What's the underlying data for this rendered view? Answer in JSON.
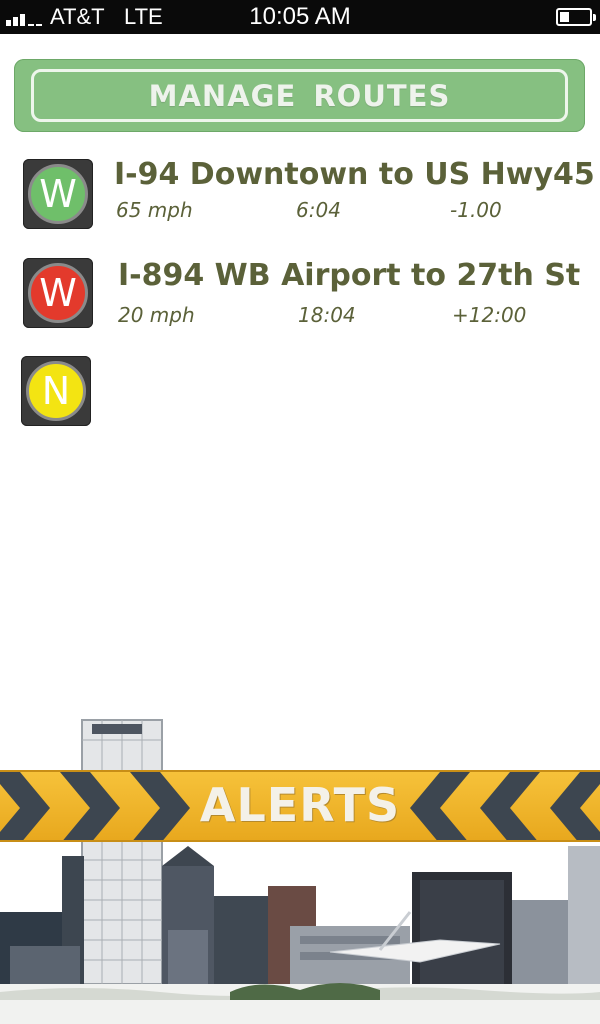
{
  "status_bar": {
    "carrier": "AT&T",
    "network": "LTE",
    "time": "10:05 AM",
    "signal_bars": 3,
    "battery_level": 0.3
  },
  "manage_routes": {
    "label": "MANAGE ROUTES"
  },
  "routes": [
    {
      "direction": "W",
      "status_color": "#6fbf6a",
      "title": "I-94 Downtown to US Hwy45",
      "speed": "65 mph",
      "time": "6:04",
      "delta": "-1.00"
    },
    {
      "direction": "W",
      "status_color": "#e33a2c",
      "title": "I-894 WB Airport to 27th St",
      "speed": "20 mph",
      "time": "18:04",
      "delta": "+12:00"
    },
    {
      "direction": "N",
      "status_color": "#f3e412",
      "title": "",
      "speed": "",
      "time": "",
      "delta": ""
    }
  ],
  "alerts": {
    "label": "ALERTS"
  },
  "colors": {
    "route_text": "#5b6139",
    "button_green": "#86c081",
    "alerts_yellow": "#f2b92e",
    "chevron_dark": "#3d4650"
  }
}
